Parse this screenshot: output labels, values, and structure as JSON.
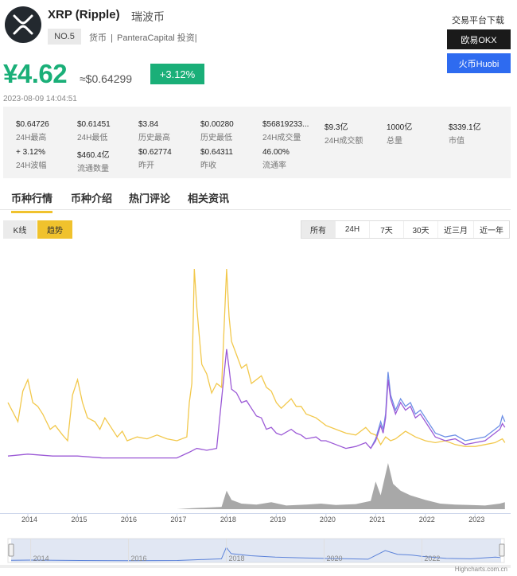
{
  "header": {
    "coin_name": "XRP (Ripple)",
    "coin_name_cn": "瑞波币",
    "rank": "NO.5",
    "tags": [
      "货币",
      "|",
      "PanteraCapital 投资|"
    ],
    "logo_icon": "xrp-logo-icon",
    "logo_color": "#23292f"
  },
  "exchange": {
    "title": "交易平台下载",
    "okx_label": "欧易OKX",
    "huobi_label": "火币Huobi",
    "okx_color": "#1a1a1a",
    "huobi_color": "#2e6bf0"
  },
  "price": {
    "main": "¥4.62",
    "usd": "≈$0.64299",
    "change": "+3.12%",
    "timestamp": "2023-08-09 14:04:51",
    "up_color": "#1aaf78"
  },
  "stats": [
    {
      "value": "$0.64726",
      "label": "24H最高"
    },
    {
      "value": "$0.61451",
      "label": "24H最低"
    },
    {
      "value": "$3.84",
      "label": "历史最高"
    },
    {
      "value": "$0.00280",
      "label": "历史最低"
    },
    {
      "value": "$56819233...",
      "label": "24H成交量"
    },
    {
      "value": "$9.3亿",
      "label": "24H成交额"
    },
    {
      "value": "1000亿",
      "label": "总量"
    },
    {
      "value": "$339.1亿",
      "label": "市值"
    },
    {
      "value": "+ 3.12%",
      "label": "24H波幅"
    },
    {
      "value": "$460.4亿",
      "label": "流通数量"
    },
    {
      "value": "$0.62774",
      "label": "昨开"
    },
    {
      "value": "$0.64311",
      "label": "昨收"
    },
    {
      "value": "46.00%",
      "label": "流通率"
    }
  ],
  "tabs": [
    {
      "label": "币种行情",
      "active": true
    },
    {
      "label": "币种介绍",
      "active": false
    },
    {
      "label": "热门评论",
      "active": false
    },
    {
      "label": "相关资讯",
      "active": false
    }
  ],
  "chart_toolbar": {
    "kline_label": "K线",
    "trend_label": "趋势",
    "ranges": [
      "所有",
      "24H",
      "7天",
      "30天",
      "近三月",
      "近一年"
    ],
    "active_range": "所有"
  },
  "chart_data": {
    "type": "line",
    "x_axis_labels": [
      "2014",
      "2015",
      "2016",
      "2017",
      "2018",
      "2019",
      "2020",
      "2021",
      "2022",
      "2023"
    ],
    "navigator_labels": [
      "2014",
      "2016",
      "2018",
      "2020",
      "2022"
    ],
    "colors": {
      "price": "#f2c84b",
      "market_cap": "#9b59d6",
      "secondary": "#6d8fe6",
      "volume": "#999999"
    },
    "series": [
      {
        "values": [
          [
            2013.6,
            0.3
          ],
          [
            2013.8,
            0.2
          ],
          [
            2013.9,
            0.36
          ],
          [
            2014.0,
            0.42
          ],
          [
            2014.1,
            0.3
          ],
          [
            2014.2,
            0.28
          ],
          [
            2014.3,
            0.24
          ],
          [
            2014.45,
            0.16
          ],
          [
            2014.55,
            0.18
          ],
          [
            2014.7,
            0.13
          ],
          [
            2014.8,
            0.1
          ],
          [
            2014.9,
            0.34
          ],
          [
            2015.0,
            0.42
          ],
          [
            2015.1,
            0.3
          ],
          [
            2015.2,
            0.22
          ],
          [
            2015.35,
            0.2
          ],
          [
            2015.45,
            0.16
          ],
          [
            2015.55,
            0.22
          ],
          [
            2015.65,
            0.18
          ],
          [
            2015.8,
            0.12
          ],
          [
            2015.9,
            0.15
          ],
          [
            2016.0,
            0.1
          ],
          [
            2016.2,
            0.12
          ],
          [
            2016.4,
            0.11
          ],
          [
            2016.6,
            0.13
          ],
          [
            2016.8,
            0.11
          ],
          [
            2017.0,
            0.1
          ],
          [
            2017.2,
            0.12
          ],
          [
            2017.25,
            0.3
          ],
          [
            2017.3,
            0.4
          ],
          [
            2017.35,
            1.0
          ],
          [
            2017.4,
            0.8
          ],
          [
            2017.45,
            0.65
          ],
          [
            2017.5,
            0.5
          ],
          [
            2017.6,
            0.45
          ],
          [
            2017.7,
            0.35
          ],
          [
            2017.8,
            0.4
          ],
          [
            2017.9,
            0.38
          ],
          [
            2017.95,
            0.7
          ],
          [
            2018.0,
            1.0
          ],
          [
            2018.05,
            0.75
          ],
          [
            2018.1,
            0.62
          ],
          [
            2018.2,
            0.55
          ],
          [
            2018.3,
            0.48
          ],
          [
            2018.4,
            0.5
          ],
          [
            2018.5,
            0.4
          ],
          [
            2018.6,
            0.42
          ],
          [
            2018.7,
            0.44
          ],
          [
            2018.8,
            0.38
          ],
          [
            2018.9,
            0.36
          ],
          [
            2019.0,
            0.3
          ],
          [
            2019.1,
            0.27
          ],
          [
            2019.3,
            0.32
          ],
          [
            2019.4,
            0.28
          ],
          [
            2019.5,
            0.28
          ],
          [
            2019.6,
            0.24
          ],
          [
            2019.8,
            0.22
          ],
          [
            2019.9,
            0.2
          ],
          [
            2020.0,
            0.18
          ],
          [
            2020.2,
            0.16
          ],
          [
            2020.4,
            0.14
          ],
          [
            2020.6,
            0.13
          ],
          [
            2020.8,
            0.17
          ],
          [
            2020.9,
            0.14
          ],
          [
            2021.0,
            0.13
          ],
          [
            2021.1,
            0.08
          ],
          [
            2021.2,
            0.12
          ],
          [
            2021.3,
            0.1
          ],
          [
            2021.4,
            0.11
          ],
          [
            2021.5,
            0.13
          ],
          [
            2021.6,
            0.15
          ],
          [
            2021.8,
            0.12
          ],
          [
            2022.0,
            0.1
          ],
          [
            2022.2,
            0.09
          ],
          [
            2022.4,
            0.1
          ],
          [
            2022.6,
            0.08
          ],
          [
            2022.8,
            0.07
          ],
          [
            2023.0,
            0.07
          ],
          [
            2023.2,
            0.08
          ],
          [
            2023.4,
            0.09
          ],
          [
            2023.55,
            0.11
          ],
          [
            2023.6,
            0.09
          ]
        ]
      },
      {
        "values": [
          [
            2013.6,
            0.02
          ],
          [
            2014.0,
            0.03
          ],
          [
            2014.5,
            0.02
          ],
          [
            2015.0,
            0.02
          ],
          [
            2015.5,
            0.01
          ],
          [
            2016.0,
            0.01
          ],
          [
            2016.5,
            0.01
          ],
          [
            2017.0,
            0.01
          ],
          [
            2017.25,
            0.04
          ],
          [
            2017.4,
            0.06
          ],
          [
            2017.6,
            0.05
          ],
          [
            2017.8,
            0.06
          ],
          [
            2017.95,
            0.45
          ],
          [
            2018.0,
            0.58
          ],
          [
            2018.05,
            0.48
          ],
          [
            2018.1,
            0.37
          ],
          [
            2018.2,
            0.35
          ],
          [
            2018.3,
            0.3
          ],
          [
            2018.4,
            0.31
          ],
          [
            2018.5,
            0.27
          ],
          [
            2018.6,
            0.23
          ],
          [
            2018.7,
            0.22
          ],
          [
            2018.8,
            0.16
          ],
          [
            2018.9,
            0.17
          ],
          [
            2019.0,
            0.14
          ],
          [
            2019.1,
            0.13
          ],
          [
            2019.3,
            0.16
          ],
          [
            2019.4,
            0.14
          ],
          [
            2019.5,
            0.13
          ],
          [
            2019.6,
            0.11
          ],
          [
            2019.8,
            0.12
          ],
          [
            2019.9,
            0.1
          ],
          [
            2020.0,
            0.1
          ],
          [
            2020.2,
            0.08
          ],
          [
            2020.4,
            0.06
          ],
          [
            2020.6,
            0.07
          ],
          [
            2020.8,
            0.09
          ],
          [
            2020.9,
            0.06
          ],
          [
            2021.0,
            0.1
          ],
          [
            2021.1,
            0.18
          ],
          [
            2021.15,
            0.14
          ],
          [
            2021.2,
            0.22
          ],
          [
            2021.25,
            0.42
          ],
          [
            2021.3,
            0.32
          ],
          [
            2021.4,
            0.24
          ],
          [
            2021.5,
            0.3
          ],
          [
            2021.6,
            0.26
          ],
          [
            2021.7,
            0.28
          ],
          [
            2021.8,
            0.22
          ],
          [
            2021.9,
            0.24
          ],
          [
            2022.0,
            0.2
          ],
          [
            2022.2,
            0.12
          ],
          [
            2022.4,
            0.1
          ],
          [
            2022.6,
            0.11
          ],
          [
            2022.8,
            0.08
          ],
          [
            2023.0,
            0.09
          ],
          [
            2023.2,
            0.1
          ],
          [
            2023.4,
            0.14
          ],
          [
            2023.5,
            0.16
          ],
          [
            2023.55,
            0.19
          ],
          [
            2023.6,
            0.17
          ]
        ]
      },
      {
        "values": [
          [
            2020.9,
            0.06
          ],
          [
            2021.0,
            0.11
          ],
          [
            2021.1,
            0.2
          ],
          [
            2021.15,
            0.16
          ],
          [
            2021.2,
            0.24
          ],
          [
            2021.25,
            0.46
          ],
          [
            2021.3,
            0.34
          ],
          [
            2021.4,
            0.26
          ],
          [
            2021.5,
            0.32
          ],
          [
            2021.6,
            0.28
          ],
          [
            2021.7,
            0.3
          ],
          [
            2021.8,
            0.24
          ],
          [
            2021.9,
            0.26
          ],
          [
            2022.0,
            0.22
          ],
          [
            2022.2,
            0.14
          ],
          [
            2022.4,
            0.12
          ],
          [
            2022.6,
            0.13
          ],
          [
            2022.8,
            0.1
          ],
          [
            2023.0,
            0.11
          ],
          [
            2023.2,
            0.12
          ],
          [
            2023.4,
            0.16
          ],
          [
            2023.5,
            0.18
          ],
          [
            2023.55,
            0.23
          ],
          [
            2023.6,
            0.2
          ]
        ]
      }
    ],
    "volume": [
      [
        2017.0,
        0.0
      ],
      [
        2017.3,
        0.02
      ],
      [
        2017.9,
        0.05
      ],
      [
        2018.0,
        0.4
      ],
      [
        2018.1,
        0.2
      ],
      [
        2018.3,
        0.12
      ],
      [
        2018.6,
        0.1
      ],
      [
        2018.9,
        0.15
      ],
      [
        2019.2,
        0.08
      ],
      [
        2019.6,
        0.1
      ],
      [
        2019.9,
        0.12
      ],
      [
        2020.2,
        0.09
      ],
      [
        2020.6,
        0.11
      ],
      [
        2020.9,
        0.18
      ],
      [
        2021.0,
        0.6
      ],
      [
        2021.1,
        0.3
      ],
      [
        2021.25,
        1.0
      ],
      [
        2021.35,
        0.55
      ],
      [
        2021.5,
        0.4
      ],
      [
        2021.7,
        0.3
      ],
      [
        2022.0,
        0.2
      ],
      [
        2022.3,
        0.12
      ],
      [
        2022.6,
        0.1
      ],
      [
        2022.9,
        0.09
      ],
      [
        2023.2,
        0.08
      ],
      [
        2023.5,
        0.12
      ],
      [
        2023.6,
        0.15
      ]
    ],
    "navigator": [
      [
        2013.6,
        0.03
      ],
      [
        2014.0,
        0.04
      ],
      [
        2015.0,
        0.02
      ],
      [
        2016.0,
        0.01
      ],
      [
        2017.0,
        0.02
      ],
      [
        2017.9,
        0.1
      ],
      [
        2018.0,
        0.65
      ],
      [
        2018.1,
        0.35
      ],
      [
        2018.5,
        0.25
      ],
      [
        2019.0,
        0.18
      ],
      [
        2019.5,
        0.15
      ],
      [
        2020.0,
        0.12
      ],
      [
        2020.5,
        0.1
      ],
      [
        2020.9,
        0.08
      ],
      [
        2021.25,
        0.5
      ],
      [
        2021.5,
        0.32
      ],
      [
        2021.8,
        0.28
      ],
      [
        2022.0,
        0.22
      ],
      [
        2022.5,
        0.12
      ],
      [
        2023.0,
        0.1
      ],
      [
        2023.5,
        0.18
      ],
      [
        2023.6,
        0.16
      ]
    ],
    "credits": "Highcharts.com.cn"
  }
}
